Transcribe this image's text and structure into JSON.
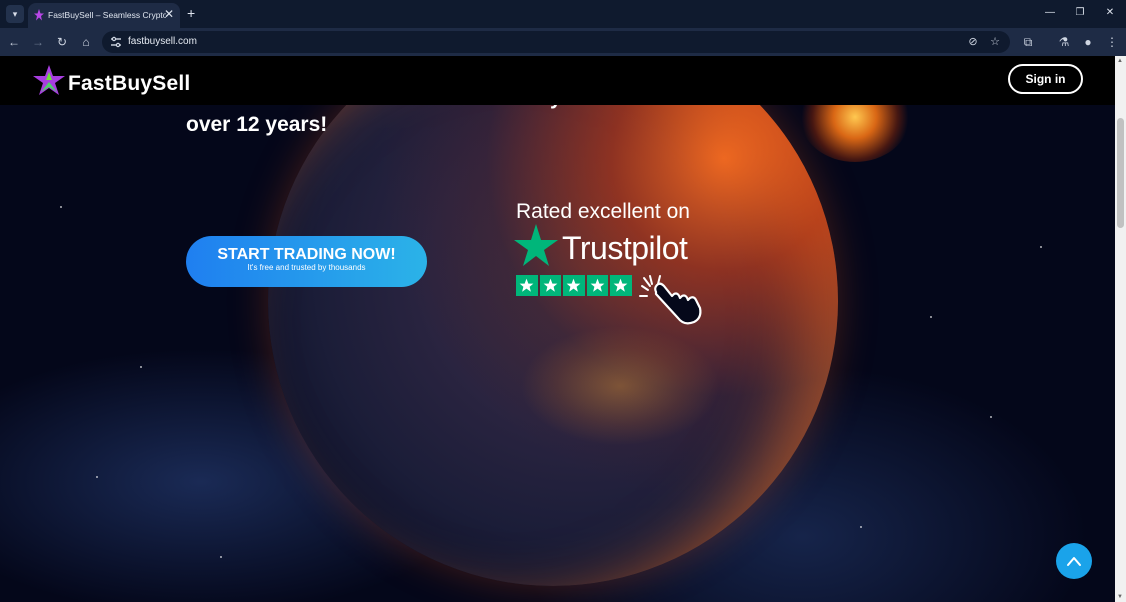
{
  "browser": {
    "tab_title": "FastBuySell – Seamless Cryptoc",
    "url": "fastbuysell.com"
  },
  "site": {
    "logo_text": "FastBuySell",
    "sign_in_label": "Sign in"
  },
  "hero": {
    "line1": "and investments. Join the community that has trusted us for",
    "line2": "over 12 years!"
  },
  "cta": {
    "title": "START TRADING NOW!",
    "subtitle": "It's free and trusted by thousands"
  },
  "trustpilot": {
    "rated_text": "Rated excellent on",
    "brand": "Trustpilot",
    "stars": 5,
    "max_stars": 5
  },
  "colors": {
    "trustpilot_green": "#00b67a",
    "cta_start": "#1f7ff0",
    "cta_end": "#2bb3e8",
    "scroll_top_button": "#1aa3ea"
  }
}
